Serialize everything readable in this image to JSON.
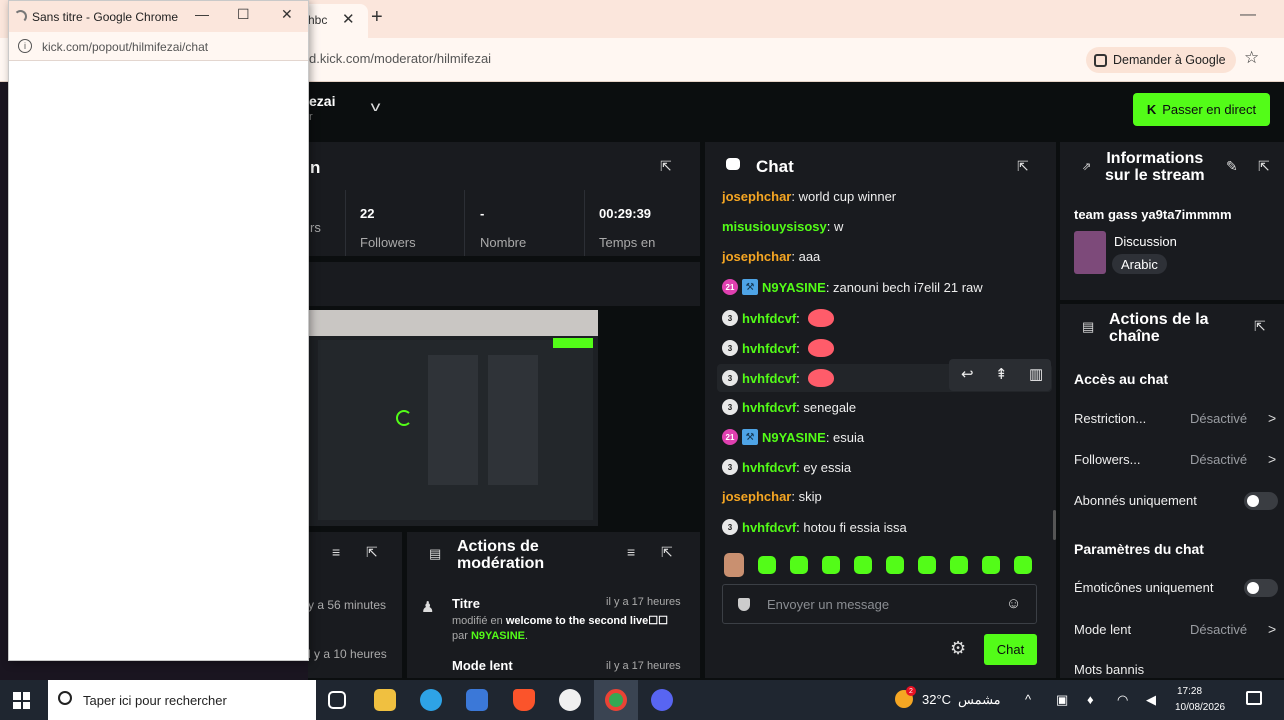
{
  "browser": {
    "tab_fragment": "hbc",
    "tab_close": "✕",
    "new_tab": "+",
    "minimize": "—",
    "url": "d.kick.com/moderator/hilmifezai",
    "ask_google": "Demander à Google",
    "star": "☆"
  },
  "header": {
    "channel_fragment": "ezai",
    "channel_sub": "r",
    "go_live_label": "Passer en direct",
    "go_live_icon": "K"
  },
  "stats": {
    "title_fragment": "n",
    "items": [
      {
        "value": "",
        "label": "rs"
      },
      {
        "value": "22",
        "label": "Followers"
      },
      {
        "value": "-",
        "label": "Nombre"
      },
      {
        "value": "00:29:39",
        "label": "Temps en"
      }
    ]
  },
  "recent_events": {
    "time1": "y a 56 minutes",
    "time2": "l y a 10 heures"
  },
  "mod_actions": {
    "title_line1": "Actions de",
    "title_line2": "modération",
    "item1_title": "Titre",
    "item1_time": "il y a 17 heures",
    "item1_prefix": "modifié en",
    "item1_value": "welcome to the second live☐☐",
    "item1_by": "par",
    "item1_user": "N9YASINE",
    "item1_suffix": ".",
    "item2_title": "Mode lent",
    "item2_time": "il y a 17 heures"
  },
  "chat": {
    "title": "Chat",
    "messages": [
      {
        "badge": "",
        "user": "josephchar",
        "user_color": "#f5a623",
        "text": ": world cup winner"
      },
      {
        "badge": "",
        "user": "misusiouysisosy",
        "user_color": "#53fc18",
        "text": ": w"
      },
      {
        "badge": "",
        "user": "josephchar",
        "user_color": "#f5a623",
        "text": ": aaa"
      },
      {
        "badge": "21",
        "user": "N9YASINE",
        "user_color": "#53fc18",
        "text": ": zanouni bech i7elil 21 raw"
      },
      {
        "badge": "3",
        "user": "hvhfdcvf",
        "user_color": "#53fc18",
        "text": ":"
      },
      {
        "badge": "3",
        "user": "hvhfdcvf",
        "user_color": "#53fc18",
        "text": ":"
      },
      {
        "badge": "3",
        "user": "hvhfdcvf",
        "user_color": "#53fc18",
        "text": ":"
      },
      {
        "badge": "3",
        "user": "hvhfdcvf",
        "user_color": "#53fc18",
        "text": ": senegale"
      },
      {
        "badge": "21",
        "user": "N9YASINE",
        "user_color": "#53fc18",
        "text": ": esuia"
      },
      {
        "badge": "3",
        "user": "hvhfdcvf",
        "user_color": "#53fc18",
        "text": ": ey essia"
      },
      {
        "badge": "",
        "user": "josephchar",
        "user_color": "#f5a623",
        "text": ": skip"
      },
      {
        "badge": "3",
        "user": "hvhfdcvf",
        "user_color": "#53fc18",
        "text": ": hotou fi essia issa"
      }
    ],
    "input_placeholder": "Envoyer un message",
    "send_label": "Chat",
    "settings_icon": "⚙",
    "emoji_icon": "☺"
  },
  "stream_info": {
    "title_line1": "Informations",
    "title_line2": "sur le stream",
    "stream_title": "team gass ya9ta7immmm",
    "category": "Discussion",
    "language": "Arabic"
  },
  "channel_actions": {
    "title_line1": "Actions de la",
    "title_line2": "chaîne",
    "section1": "Accès au chat",
    "restriction_label": "Restriction...",
    "restriction_value": "Désactivé",
    "followers_label": "Followers...",
    "followers_value": "Désactivé",
    "subs_only_label": "Abonnés uniquement",
    "section2": "Paramètres du chat",
    "emotes_only_label": "Émoticônes uniquement",
    "slow_mode_label": "Mode lent",
    "slow_mode_value": "Désactivé",
    "banned_words_label": "Mots bannis"
  },
  "popup": {
    "title": "Sans titre - Google Chrome",
    "url": "kick.com/popout/hilmifezai/chat",
    "min": "—",
    "max": "☐",
    "close": "✕",
    "info_icon": "i"
  },
  "taskbar": {
    "search_placeholder": "Taper ici pour rechercher",
    "temperature": "32°C",
    "weather": "مشمس",
    "weather_badge": "2",
    "time": "17:28",
    "date": "10/08/2026"
  }
}
